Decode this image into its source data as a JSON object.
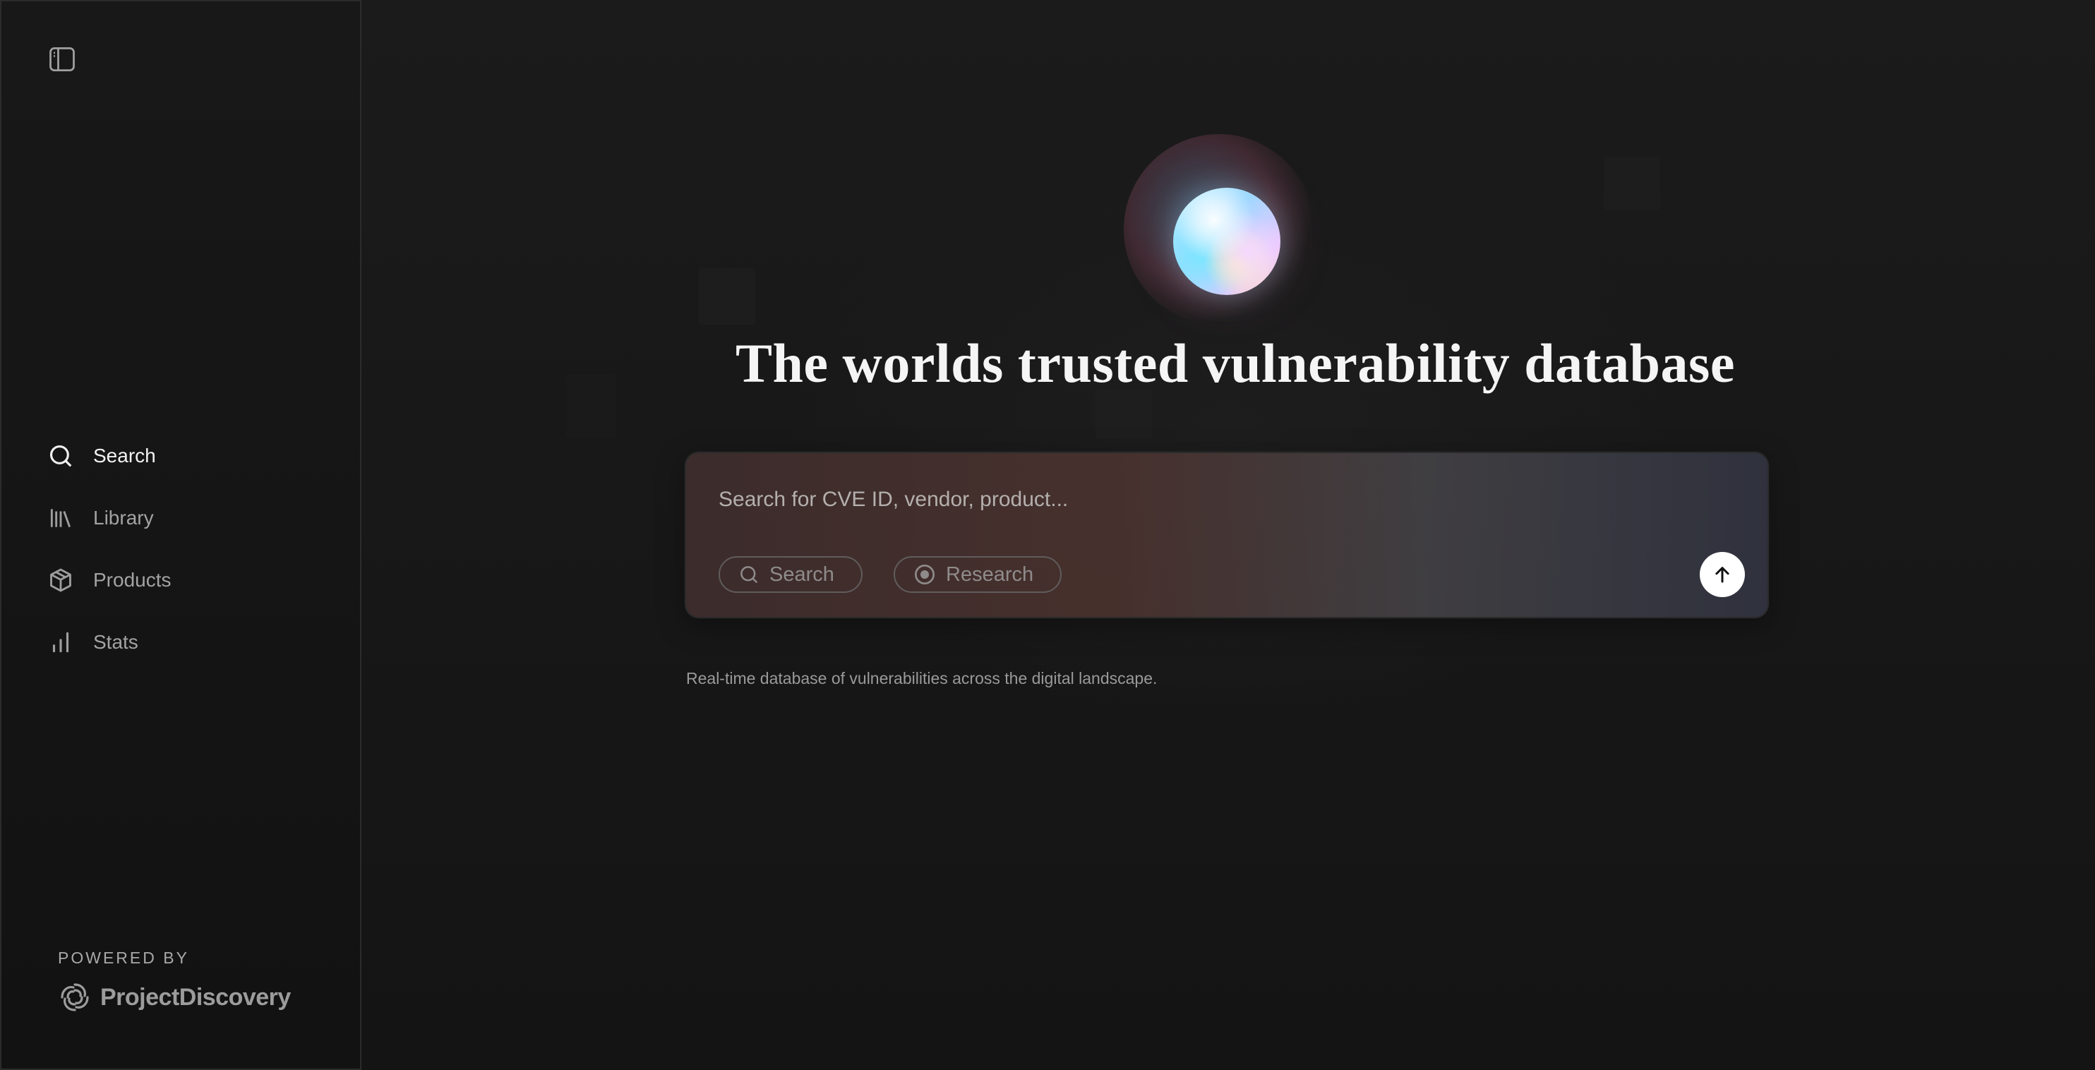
{
  "sidebar": {
    "toggle_icon": "sidebar-panel-icon",
    "items": [
      {
        "label": "Search",
        "icon": "search-icon",
        "active": true
      },
      {
        "label": "Library",
        "icon": "library-icon",
        "active": false
      },
      {
        "label": "Products",
        "icon": "box-icon",
        "active": false
      },
      {
        "label": "Stats",
        "icon": "bar-chart-icon",
        "active": false
      }
    ],
    "powered_by": "POWERED BY",
    "brand_name": "ProjectDiscovery"
  },
  "main": {
    "headline": "The worlds trusted vulnerability database",
    "search": {
      "placeholder": "Search for CVE ID, vendor, product...",
      "modes": [
        {
          "label": "Search",
          "icon": "search-icon"
        },
        {
          "label": "Research",
          "icon": "radio-dot-icon"
        }
      ],
      "submit_icon": "arrow-up-icon"
    },
    "tagline": "Real-time database of vulnerabilities across the digital landscape."
  },
  "colors": {
    "background": "#161616",
    "sidebar_border": "#2c2c2c",
    "text_primary": "#f5f5f5",
    "text_muted": "#a3a3a3",
    "submit_button": "#ffffff"
  }
}
